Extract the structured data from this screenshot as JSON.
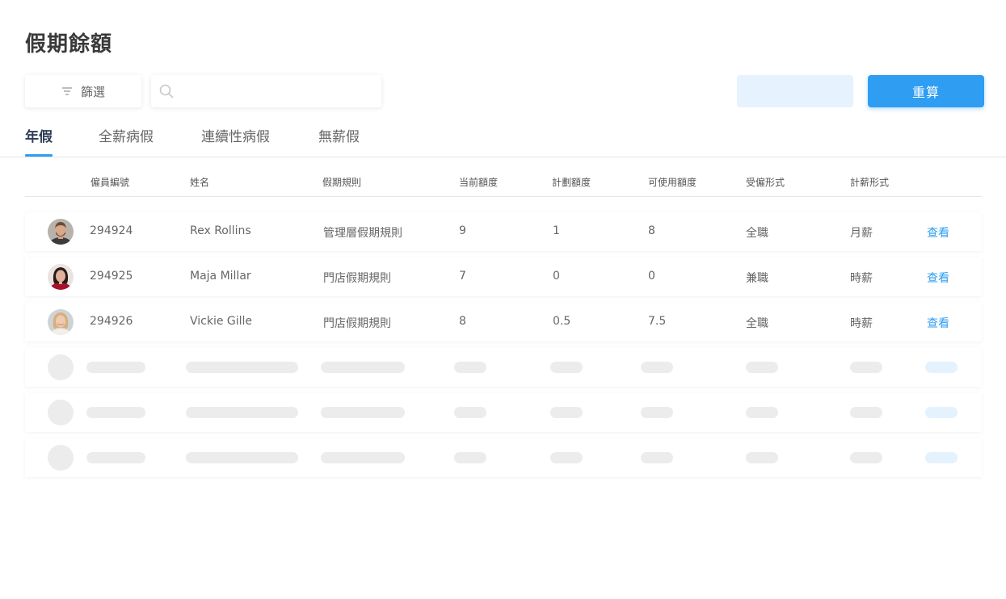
{
  "header": {
    "title": "假期餘額"
  },
  "toolbar": {
    "filter_label": "篩選",
    "search_placeholder": "",
    "search_value": "",
    "recalc_label": "重算"
  },
  "tabs": [
    {
      "label": "年假",
      "active": true
    },
    {
      "label": "全薪病假",
      "active": false
    },
    {
      "label": "連續性病假",
      "active": false
    },
    {
      "label": "無薪假",
      "active": false
    }
  ],
  "table": {
    "columns": [
      "僱員編號",
      "姓名",
      "假期規則",
      "当前額度",
      "計劃額度",
      "可使用額度",
      "受僱形式",
      "計薪形式"
    ],
    "rows": [
      {
        "id": "294924",
        "name": "Rex Rollins",
        "rule": "管理層假期規則",
        "current": "9",
        "planned": "1",
        "available": "8",
        "employment": "全職",
        "pay": "月薪",
        "action": "查看"
      },
      {
        "id": "294925",
        "name": "Maja Millar",
        "rule": "門店假期規則",
        "current": "7",
        "planned": "0",
        "available": "0",
        "employment": "兼職",
        "pay": "時薪",
        "action": "查看"
      },
      {
        "id": "294926",
        "name": "Vickie Gille",
        "rule": "門店假期規則",
        "current": "8",
        "planned": "0.5",
        "available": "7.5",
        "employment": "全職",
        "pay": "時薪",
        "action": "查看"
      }
    ]
  },
  "colors": {
    "accent": "#2e9df2",
    "accent_light": "#e6f3fe"
  }
}
